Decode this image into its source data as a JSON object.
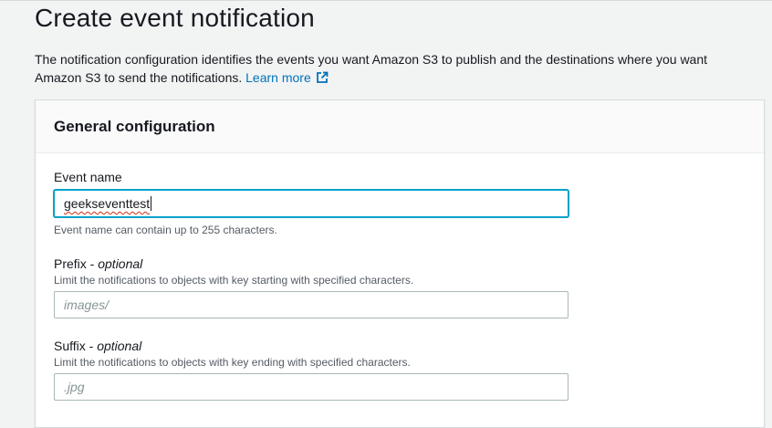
{
  "page": {
    "title": "Create event notification",
    "description": "The notification configuration identifies the events you want Amazon S3 to publish and the destinations where you want Amazon S3 to send the notifications.",
    "learn_more": "Learn more"
  },
  "general_config": {
    "title": "General configuration",
    "event_name": {
      "label": "Event name",
      "value": "geekseventtest",
      "hint": "Event name can contain up to 255 characters."
    },
    "prefix": {
      "label": "Prefix - ",
      "optional": "optional",
      "hint": "Limit the notifications to objects with key starting with specified characters.",
      "placeholder": "images/"
    },
    "suffix": {
      "label": "Suffix - ",
      "optional": "optional",
      "hint": "Limit the notifications to objects with key ending with specified characters.",
      "placeholder": ".jpg"
    }
  },
  "colors": {
    "link": "#0073bb",
    "focus": "#00a1c9",
    "spellcheck": "#d13212"
  },
  "icons": {
    "learn_more": "external-link-icon"
  }
}
